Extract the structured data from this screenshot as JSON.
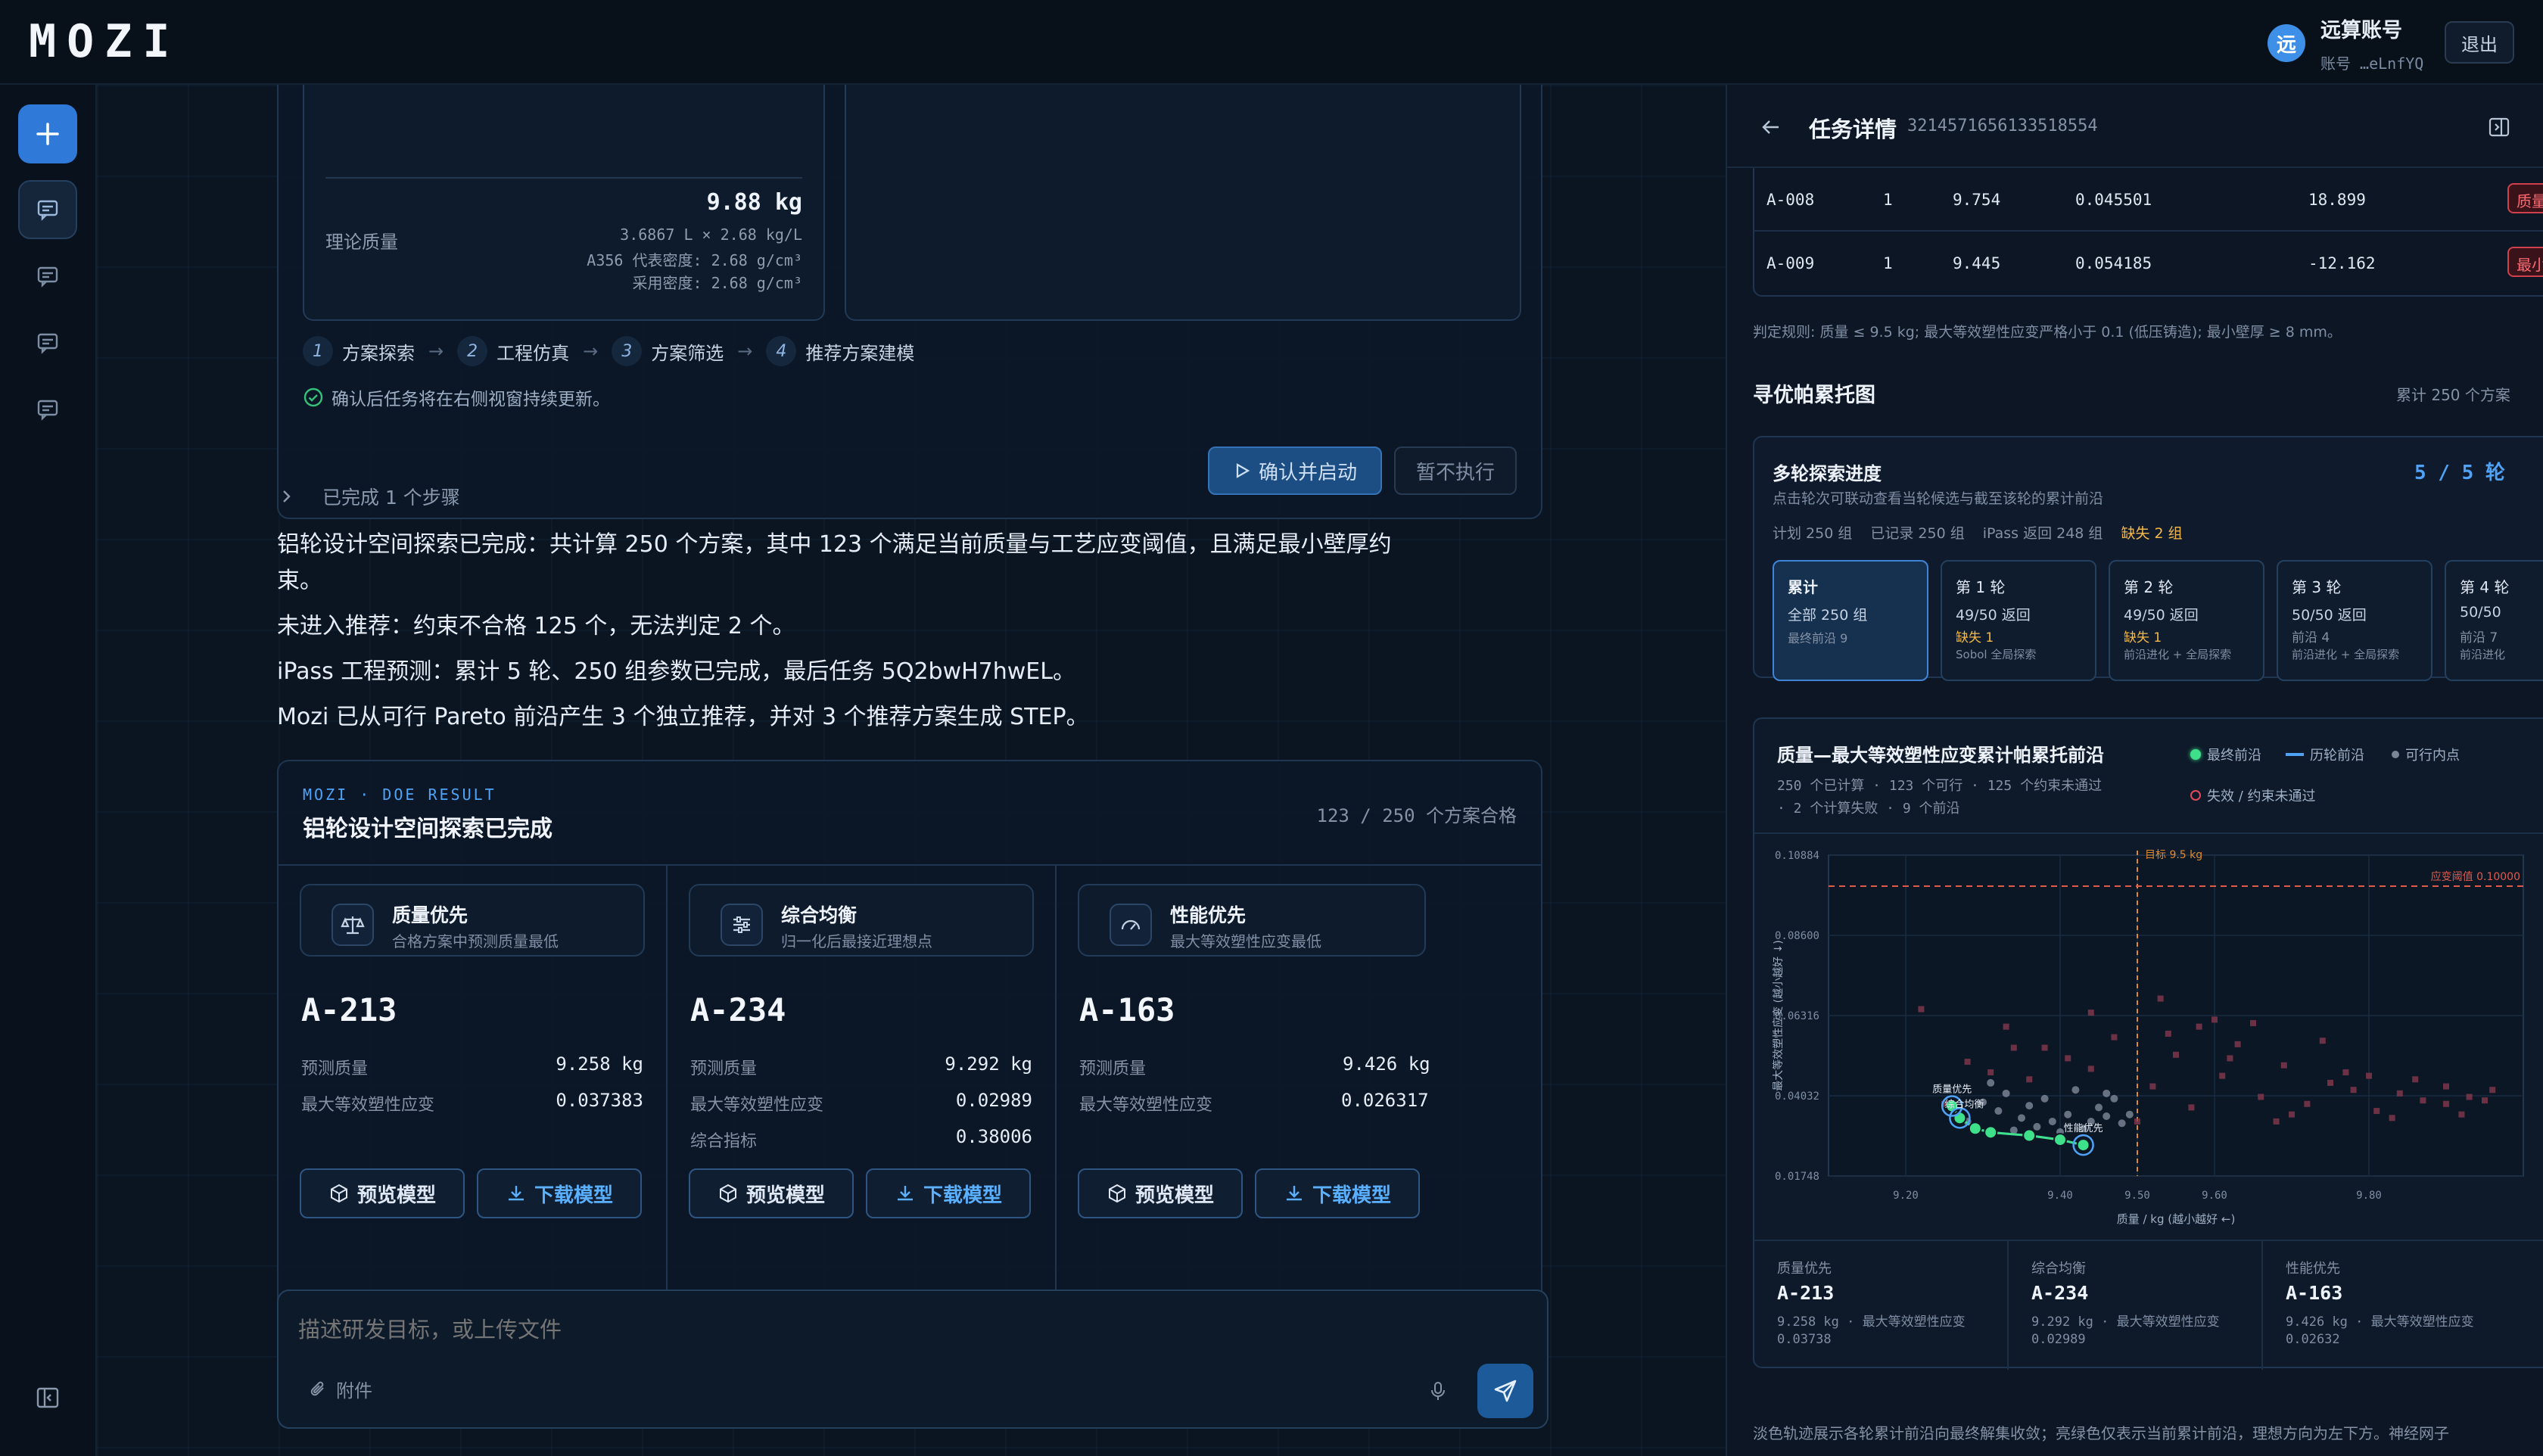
{
  "app": {
    "logo": "MOZI"
  },
  "account": {
    "avatar": "远",
    "name": "远算账号",
    "id": "账号 …eLnfYQ",
    "logout": "退出"
  },
  "upper_card": {
    "mass_value": "9.88 kg",
    "mass_label": "理论质量",
    "mass_line1": "3.6867 L × 2.68 kg/L",
    "mass_line2": "A356 代表密度: 2.68 g/cm³",
    "mass_line3": "采用密度: 2.68 g/cm³",
    "steps": [
      {
        "num": "1",
        "label": "方案探索"
      },
      {
        "num": "2",
        "label": "工程仿真"
      },
      {
        "num": "3",
        "label": "方案筛选"
      },
      {
        "num": "4",
        "label": "推荐方案建模"
      }
    ],
    "note": "确认后任务将在右侧视窗持续更新。",
    "confirm_btn": "确认并启动",
    "skip_btn": "暂不执行"
  },
  "completed_steps": "已完成 1 个步骤",
  "paragraphs": [
    "铝轮设计空间探索已完成：共计算 250 个方案，其中 123 个满足当前质量与工艺应变阈值，且满足最小壁厚约束。",
    "未进入推荐：约束不合格 125 个，无法判定 2 个。",
    "iPass 工程预测：累计 5 轮、250 组参数已完成，最后任务 5Q2bwH7hwEL。",
    "Mozi 已从可行 Pareto 前沿产生 3 个独立推荐，并对 3 个推荐方案生成 STEP。"
  ],
  "doe": {
    "eyebrow": "MOZI · DOE RESULT",
    "title": "铝轮设计空间探索已完成",
    "count": "123 / 250 个方案合格",
    "cards": [
      {
        "title": "质量优先",
        "desc": "合格方案中预测质量最低",
        "id": "A-213",
        "rows": [
          [
            "预测质量",
            "9.258 kg"
          ],
          [
            "最大等效塑性应变",
            "0.037383"
          ]
        ]
      },
      {
        "title": "综合均衡",
        "desc": "归一化后最接近理想点",
        "id": "A-234",
        "rows": [
          [
            "预测质量",
            "9.292 kg"
          ],
          [
            "最大等效塑性应变",
            "0.02989"
          ],
          [
            "综合指标",
            "0.38006"
          ]
        ]
      },
      {
        "title": "性能优先",
        "desc": "最大等效塑性应变最低",
        "id": "A-163",
        "rows": [
          [
            "预测质量",
            "9.426 kg"
          ],
          [
            "最大等效塑性应变",
            "0.026317"
          ]
        ]
      }
    ],
    "preview_btn": "预览模型",
    "download_btn": "下载模型"
  },
  "composer": {
    "placeholder": "描述研发目标，或上传文件",
    "attach": "附件"
  },
  "panel": {
    "title": "任务详情",
    "task_id": "3214571656133518554",
    "rows": [
      [
        "A-008",
        "1",
        "9.754",
        "0.045501",
        "18.899",
        "质量"
      ],
      [
        "A-009",
        "1",
        "9.445",
        "0.054185",
        "-12.162",
        "最小"
      ]
    ],
    "rule": "判定规则: 质量 ≤ 9.5 kg; 最大等效塑性应变严格小于 0.1 (低压铸造); 最小壁厚 ≥ 8 mm。",
    "pareto_title": "寻优帕累托图",
    "pareto_total": "累计 250 个方案",
    "progress": {
      "title": "多轮探索进度",
      "count": "5 / 5 轮",
      "hint": "点击轮次可联动查看当轮候选与截至该轮的累计前沿",
      "stats": [
        "计划 250 组",
        "已记录 250 组",
        "iPass 返回 248 组"
      ],
      "missing": "缺失 2 组",
      "rounds": [
        {
          "title": "累计",
          "line1": "全部 250 组",
          "miss": "",
          "line2": "最终前沿 9"
        },
        {
          "title": "第 1 轮",
          "line1": "49/50 返回",
          "miss": "缺失 1",
          "line2": "Sobol 全局探索"
        },
        {
          "title": "第 2 轮",
          "line1": "49/50 返回",
          "miss": "缺失 1",
          "line2": "前沿进化 + 全局探索"
        },
        {
          "title": "第 3 轮",
          "line1": "50/50 返回",
          "miss": "前沿 4",
          "line2": "前沿进化 + 全局探索"
        },
        {
          "title": "第 4 轮",
          "line1": "50/50",
          "miss": "前沿 7",
          "line2": "前沿进化"
        }
      ]
    },
    "chart_card": {
      "title": "质量—最大等效塑性应变累计帕累托前沿",
      "sub1": "250 个已计算 · 123 个可行 · 125 个约束未通过",
      "sub2": "· 2 个计算失败 · 9 个前沿",
      "legend": [
        "最终前沿",
        "历轮前沿",
        "可行内点",
        "失效 / 约束未通过"
      ]
    },
    "recs": [
      {
        "title": "质量优先",
        "id": "A-213",
        "line1": "9.258 kg · 最大等效塑性应变",
        "line2": "0.03738"
      },
      {
        "title": "综合均衡",
        "id": "A-234",
        "line1": "9.292 kg · 最大等效塑性应变",
        "line2": "0.02989"
      },
      {
        "title": "性能优先",
        "id": "A-163",
        "line1": "9.426 kg · 最大等效塑性应变",
        "line2": "0.02632"
      }
    ],
    "footer": "淡色轨迹展示各轮累计前沿向最终解集收敛；亮绿色仅表示当前累计前沿，理想方向为左下方。神经网子"
  },
  "chart_data": {
    "type": "scatter",
    "xlabel": "质量 / kg (越小越好 ←)",
    "ylabel": "最大等效塑性应变 (越小越好 ↓)",
    "x_ticks": [
      "9.20",
      "9.40",
      "9.50",
      "9.60",
      "9.80"
    ],
    "y_ticks": [
      "0.10884",
      "0.08600",
      "0.06316",
      "0.04032",
      "0.01748"
    ],
    "xlim": [
      9.1,
      10.0
    ],
    "ylim": [
      0.01748,
      0.10884
    ],
    "threshold_x_label": "目标 9.5 kg",
    "threshold_x": 9.5,
    "threshold_y_label": "应变阈值 0.10000",
    "threshold_y": 0.1,
    "front_labels": [
      "质量优先",
      "综合均衡",
      "性能优先"
    ],
    "front": {
      "x": [
        9.26,
        9.27,
        9.29,
        9.31,
        9.36,
        9.4,
        9.43
      ],
      "y": [
        0.0374,
        0.034,
        0.031,
        0.0299,
        0.029,
        0.0278,
        0.0263
      ]
    },
    "feasible": {
      "x": [
        9.3,
        9.32,
        9.33,
        9.35,
        9.36,
        9.38,
        9.39,
        9.41,
        9.42,
        9.44,
        9.45,
        9.46,
        9.47,
        9.48,
        9.34,
        9.37,
        9.4,
        9.43,
        9.31,
        9.46,
        9.28,
        9.49
      ],
      "y": [
        0.0385,
        0.036,
        0.041,
        0.034,
        0.0375,
        0.0395,
        0.033,
        0.035,
        0.042,
        0.033,
        0.037,
        0.0345,
        0.0395,
        0.0325,
        0.0305,
        0.0315,
        0.03,
        0.031,
        0.044,
        0.041,
        0.033,
        0.035
      ]
    },
    "failed": {
      "x": [
        9.22,
        9.25,
        9.28,
        9.31,
        9.34,
        9.36,
        9.41,
        9.44,
        9.47,
        9.52,
        9.55,
        9.58,
        9.61,
        9.63,
        9.66,
        9.69,
        9.72,
        9.75,
        9.78,
        9.81,
        9.84,
        9.87,
        9.9,
        9.93,
        9.96,
        9.54,
        9.6,
        9.7,
        9.8,
        9.9,
        9.5,
        9.57,
        9.65,
        9.74,
        9.83,
        9.92,
        9.33,
        9.38,
        9.44,
        9.62,
        9.68,
        9.86,
        9.95,
        9.53,
        9.77
      ],
      "y": [
        0.065,
        0.038,
        0.05,
        0.047,
        0.054,
        0.045,
        0.051,
        0.048,
        0.057,
        0.043,
        0.052,
        0.06,
        0.046,
        0.055,
        0.04,
        0.049,
        0.038,
        0.044,
        0.042,
        0.036,
        0.041,
        0.039,
        0.043,
        0.04,
        0.042,
        0.058,
        0.062,
        0.035,
        0.046,
        0.038,
        0.033,
        0.037,
        0.061,
        0.056,
        0.034,
        0.035,
        0.06,
        0.054,
        0.064,
        0.051,
        0.033,
        0.045,
        0.039,
        0.068,
        0.047
      ]
    }
  }
}
